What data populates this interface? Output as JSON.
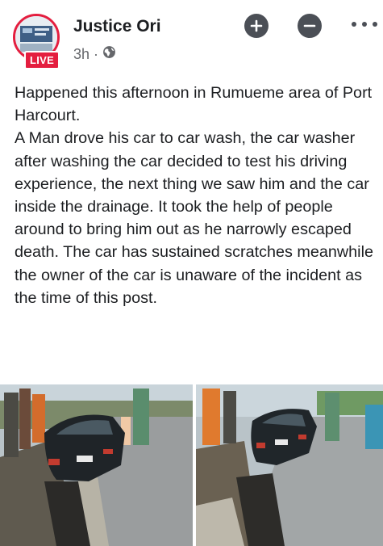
{
  "post": {
    "author_name": "Justice Ori",
    "live_label": "LIVE",
    "time": "3h",
    "separator": "·",
    "privacy_icon": "globe-icon",
    "text": "Happened this afternoon in Rumueme area of Port Harcourt.\nA Man drove his car to car wash, the car washer after washing the car decided to test his driving experience, the next thing we saw him and the car inside the drainage. It took the help of people around to bring him out as he narrowly escaped death. The car has sustained scratches meanwhile the owner of the car is unaware of the incident as the time of this post."
  },
  "actions": {
    "add_icon": "plus-circle-icon",
    "remove_icon": "minus-circle-icon",
    "more_icon": "more-horizontal-icon"
  },
  "photos": [
    "car-in-drainage-photo-1",
    "car-in-drainage-photo-2"
  ],
  "colors": {
    "live_red": "#e41e3f",
    "icon_gray": "#4b4f56",
    "meta_gray": "#65676b",
    "text": "#1c1e21"
  }
}
